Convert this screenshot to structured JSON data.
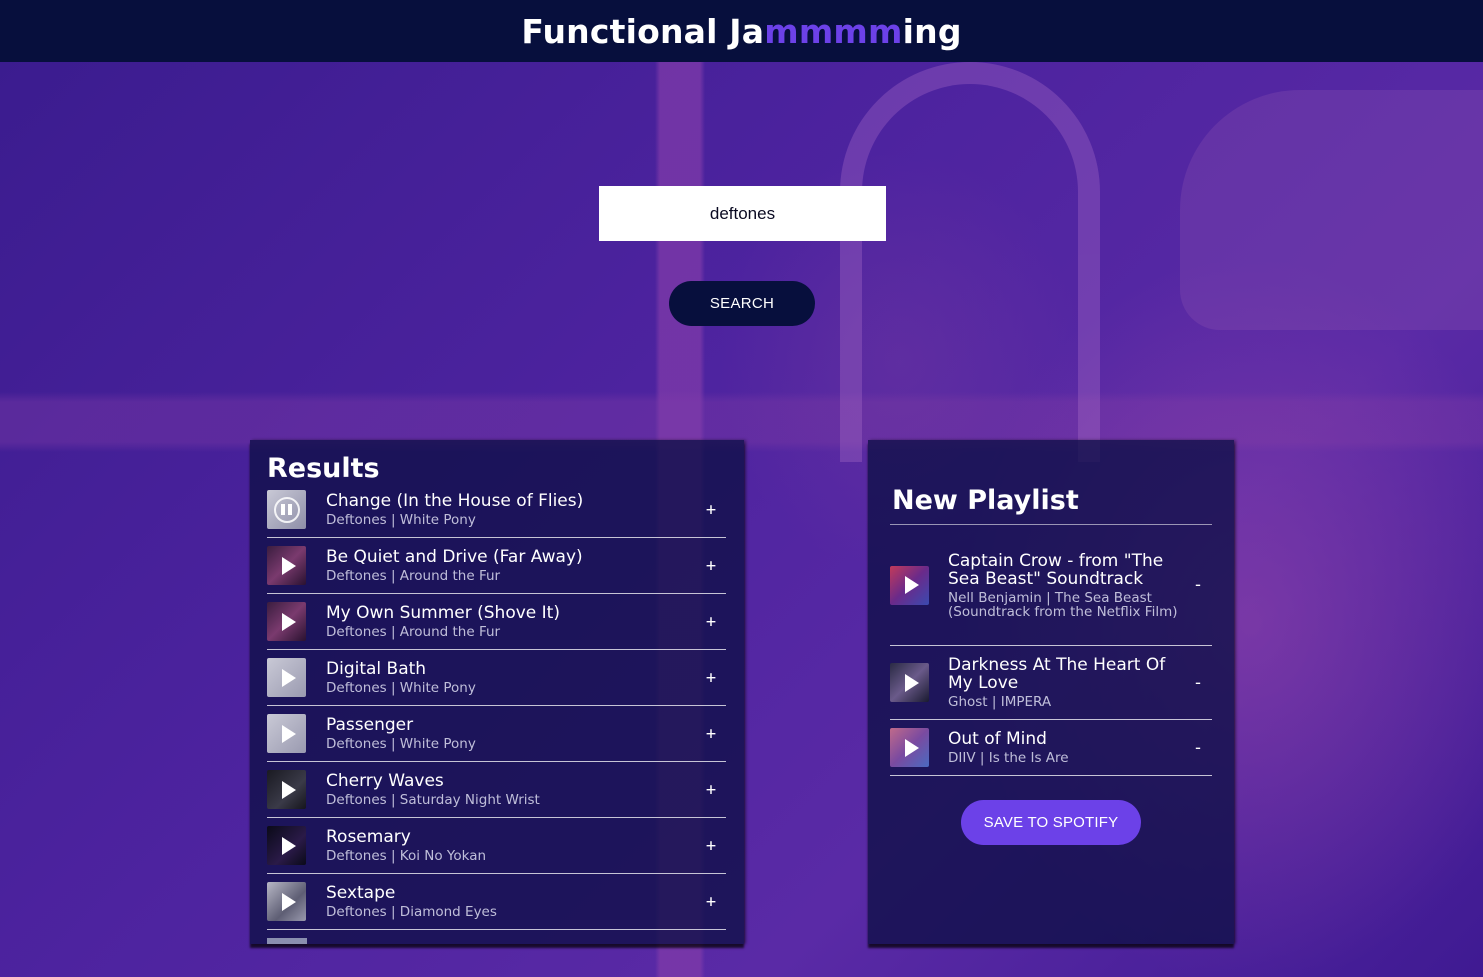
{
  "header": {
    "title_part1": "Functional Ja",
    "title_accent": "mmmm",
    "title_part2": "ing"
  },
  "search": {
    "value": "deftones",
    "button_label": "SEARCH"
  },
  "results": {
    "title": "Results",
    "tracks": [
      {
        "name": "Change (In the House of Flies)",
        "meta": "Deftones | White Pony",
        "state": "playing",
        "action": "+"
      },
      {
        "name": "Be Quiet and Drive (Far Away)",
        "meta": "Deftones | Around the Fur",
        "state": "paused",
        "action": "+"
      },
      {
        "name": "My Own Summer (Shove It)",
        "meta": "Deftones | Around the Fur",
        "state": "paused",
        "action": "+"
      },
      {
        "name": "Digital Bath",
        "meta": "Deftones | White Pony",
        "state": "paused",
        "action": "+"
      },
      {
        "name": "Passenger",
        "meta": "Deftones | White Pony",
        "state": "paused",
        "action": "+"
      },
      {
        "name": "Cherry Waves",
        "meta": "Deftones | Saturday Night Wrist",
        "state": "paused",
        "action": "+"
      },
      {
        "name": "Rosemary",
        "meta": "Deftones | Koi No Yokan",
        "state": "paused",
        "action": "+"
      },
      {
        "name": "Sextape",
        "meta": "Deftones | Diamond Eyes",
        "state": "paused",
        "action": "+"
      }
    ]
  },
  "playlist": {
    "title": "New Playlist",
    "tracks": [
      {
        "name": "Captain Crow - from \"The Sea Beast\" Soundtrack",
        "meta": "Nell Benjamin | The Sea Beast (Soundtrack from the Netflix Film)",
        "action": "-"
      },
      {
        "name": "Darkness At The Heart Of My Love",
        "meta": "Ghost | IMPERA",
        "action": "-"
      },
      {
        "name": "Out of Mind",
        "meta": "DIIV | Is the Is Are",
        "action": "-"
      }
    ],
    "save_label": "SAVE TO SPOTIFY"
  },
  "colors": {
    "header_bg": "#070f3d",
    "accent": "#6c41e8",
    "panel_bg": "rgba(14,16,70,0.78)"
  },
  "icons": {
    "play": "play-icon",
    "pause": "pause-icon"
  }
}
